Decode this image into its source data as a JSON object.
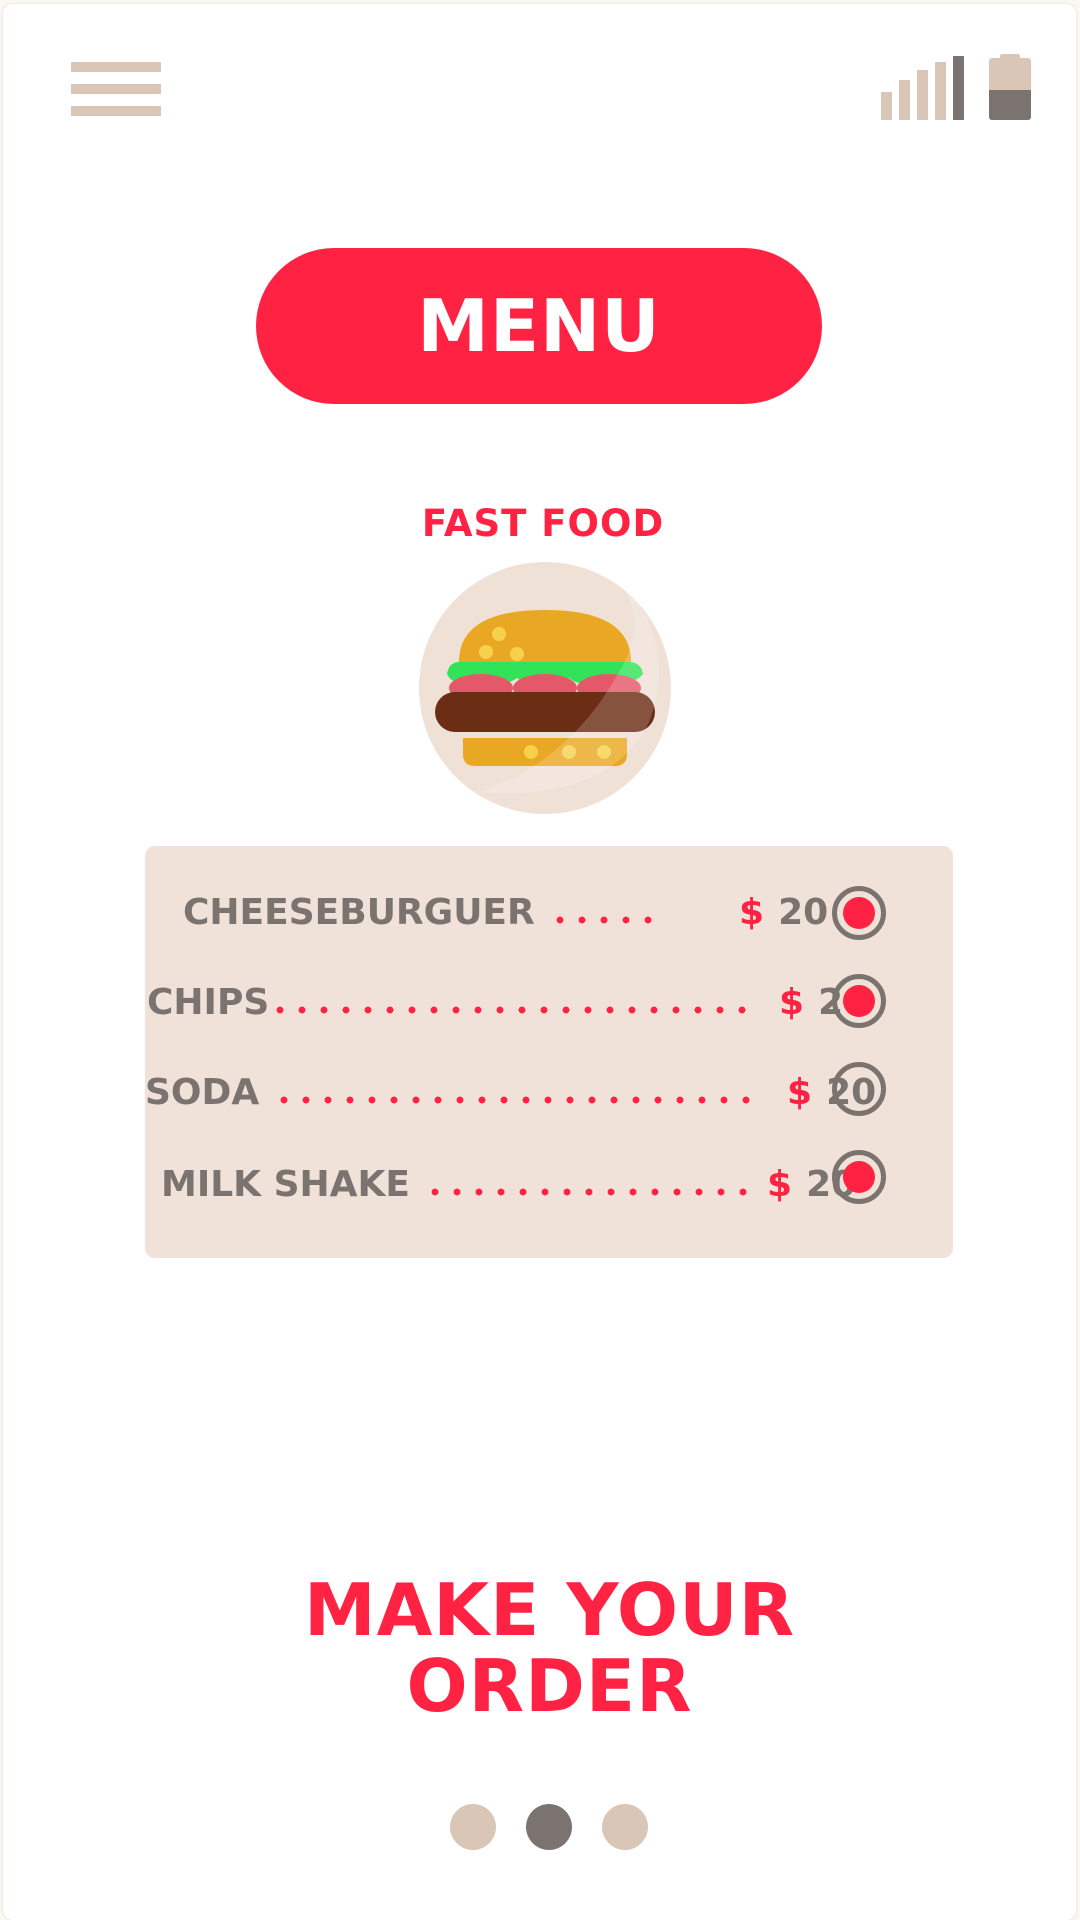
{
  "header": {
    "menu_icon": "hamburger-icon",
    "signal_icon": "signal-icon",
    "battery_icon": "battery-icon"
  },
  "menu_button": {
    "label": "MENU"
  },
  "category": {
    "title": "FAST FOOD",
    "image": "burger-icon"
  },
  "items": [
    {
      "name": "CHEESEBURGUER",
      "currency": "$",
      "price": "20",
      "selected": true
    },
    {
      "name": "CHIPS",
      "currency": "$",
      "price": "20",
      "selected": true
    },
    {
      "name": "SODA",
      "currency": "$",
      "price": "20",
      "selected": false
    },
    {
      "name": "MILK SHAKE",
      "currency": "$",
      "price": "20",
      "selected": true
    }
  ],
  "cta": {
    "line1": "MAKE YOUR",
    "line2": "ORDER"
  },
  "pager": {
    "count": 3,
    "active_index": 1
  },
  "colors": {
    "accent": "#ff2242",
    "beige": "#d9c6b6",
    "card": "#f0e2d8",
    "gray": "#7b7370"
  }
}
